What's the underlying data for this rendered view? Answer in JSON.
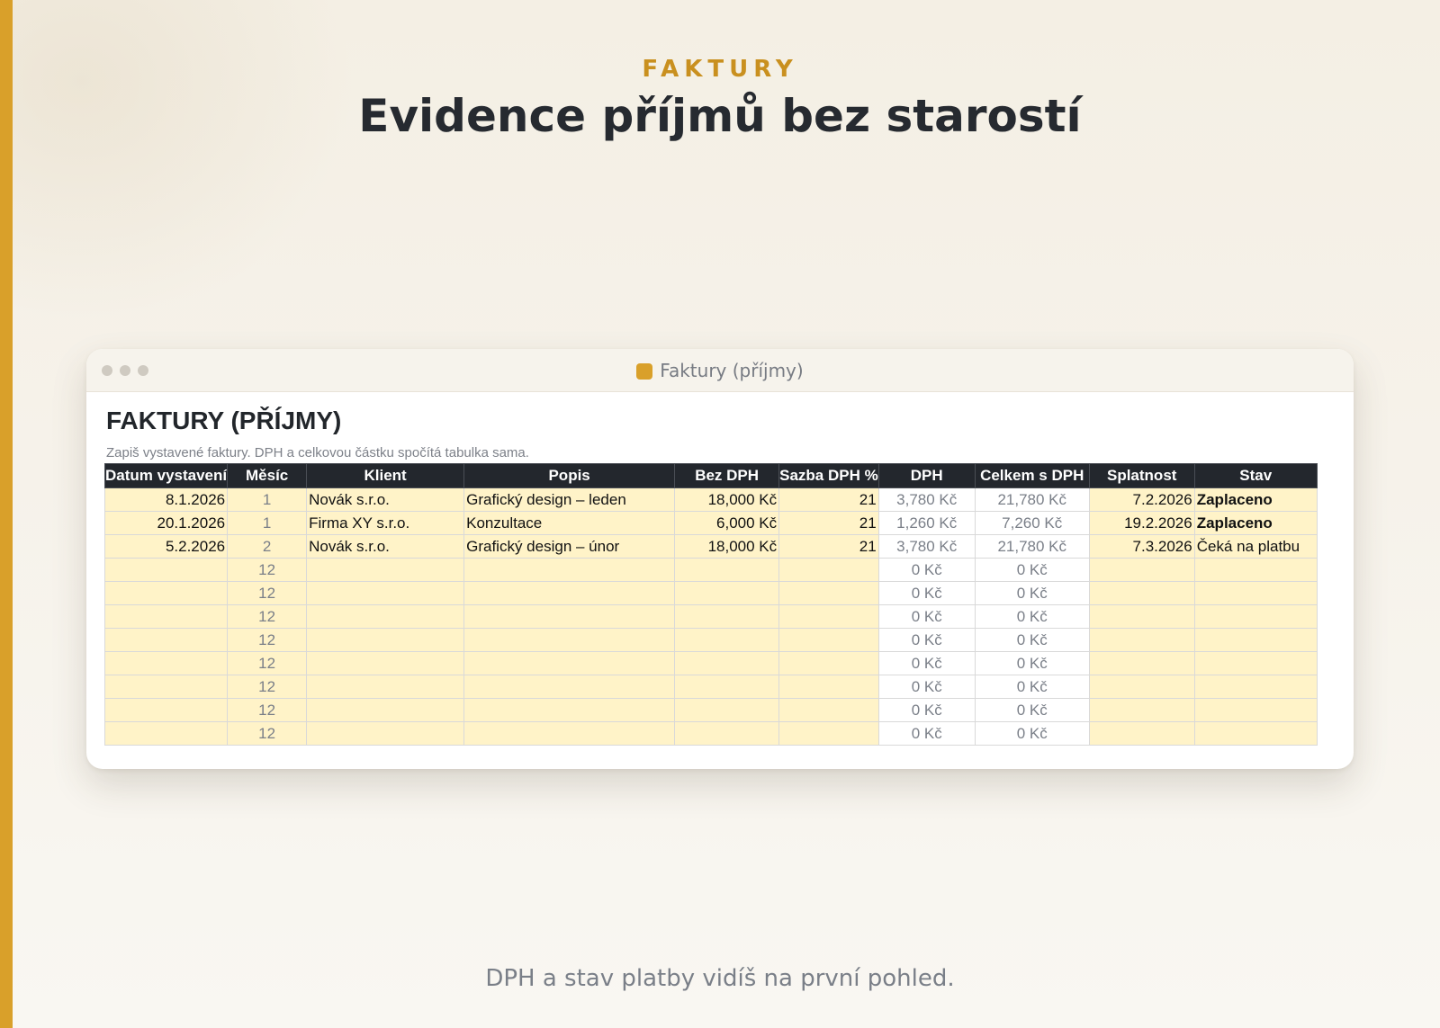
{
  "hero": {
    "eyebrow": "FAKTURY",
    "headline": "Evidence příjmů bez starostí",
    "caption": "DPH a stav platby vidíš na první pohled."
  },
  "window": {
    "title": "Faktury (příjmy)"
  },
  "sheet": {
    "title": "FAKTURY (PŘÍJMY)",
    "subtitle": "Zapiš vystavené faktury. DPH a celkovou částku spočítá tabulka sama.",
    "columns": [
      "Datum vystavení",
      "Měsíc",
      "Klient",
      "Popis",
      "Bez DPH",
      "Sazba DPH %",
      "DPH",
      "Celkem s DPH",
      "Splatnost",
      "Stav"
    ],
    "rows": [
      {
        "date": "8.1.2026",
        "month": "1",
        "client": "Novák s.r.o.",
        "desc": "Grafický design – leden",
        "net": "18,000 Kč",
        "rate": "21",
        "vat": "3,780 Kč",
        "total": "21,780 Kč",
        "due": "7.2.2026",
        "status": "Zaplaceno"
      },
      {
        "date": "20.1.2026",
        "month": "1",
        "client": "Firma XY s.r.o.",
        "desc": "Konzultace",
        "net": "6,000 Kč",
        "rate": "21",
        "vat": "1,260 Kč",
        "total": "7,260 Kč",
        "due": "19.2.2026",
        "status": "Zaplaceno"
      },
      {
        "date": "5.2.2026",
        "month": "2",
        "client": "Novák s.r.o.",
        "desc": "Grafický design – únor",
        "net": "18,000 Kč",
        "rate": "21",
        "vat": "3,780 Kč",
        "total": "21,780 Kč",
        "due": "7.3.2026",
        "status": "Čeká na platbu"
      },
      {
        "date": "",
        "month": "12",
        "client": "",
        "desc": "",
        "net": "",
        "rate": "",
        "vat": "0 Kč",
        "total": "0 Kč",
        "due": "",
        "status": ""
      },
      {
        "date": "",
        "month": "12",
        "client": "",
        "desc": "",
        "net": "",
        "rate": "",
        "vat": "0 Kč",
        "total": "0 Kč",
        "due": "",
        "status": ""
      },
      {
        "date": "",
        "month": "12",
        "client": "",
        "desc": "",
        "net": "",
        "rate": "",
        "vat": "0 Kč",
        "total": "0 Kč",
        "due": "",
        "status": ""
      },
      {
        "date": "",
        "month": "12",
        "client": "",
        "desc": "",
        "net": "",
        "rate": "",
        "vat": "0 Kč",
        "total": "0 Kč",
        "due": "",
        "status": ""
      },
      {
        "date": "",
        "month": "12",
        "client": "",
        "desc": "",
        "net": "",
        "rate": "",
        "vat": "0 Kč",
        "total": "0 Kč",
        "due": "",
        "status": ""
      },
      {
        "date": "",
        "month": "12",
        "client": "",
        "desc": "",
        "net": "",
        "rate": "",
        "vat": "0 Kč",
        "total": "0 Kč",
        "due": "",
        "status": ""
      },
      {
        "date": "",
        "month": "12",
        "client": "",
        "desc": "",
        "net": "",
        "rate": "",
        "vat": "0 Kč",
        "total": "0 Kč",
        "due": "",
        "status": ""
      },
      {
        "date": "",
        "month": "12",
        "client": "",
        "desc": "",
        "net": "",
        "rate": "",
        "vat": "0 Kč",
        "total": "0 Kč",
        "due": "",
        "status": ""
      }
    ]
  },
  "colors": {
    "accent": "#d9a02a",
    "header_bg": "#23272d",
    "input_cell": "#fff3c8",
    "paid": "#1f7a2e"
  },
  "icons": {
    "window_dots": "traffic-light-dots",
    "file": "spreadsheet-file-icon"
  }
}
